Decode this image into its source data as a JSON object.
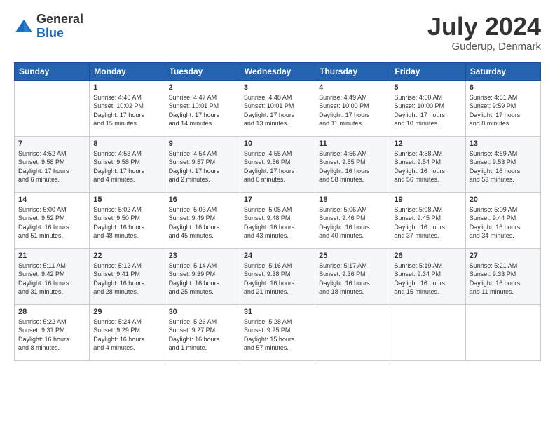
{
  "header": {
    "logo_general": "General",
    "logo_blue": "Blue",
    "month_title": "July 2024",
    "location": "Guderup, Denmark"
  },
  "columns": [
    "Sunday",
    "Monday",
    "Tuesday",
    "Wednesday",
    "Thursday",
    "Friday",
    "Saturday"
  ],
  "weeks": [
    [
      {
        "day": "",
        "info": ""
      },
      {
        "day": "1",
        "info": "Sunrise: 4:46 AM\nSunset: 10:02 PM\nDaylight: 17 hours\nand 15 minutes."
      },
      {
        "day": "2",
        "info": "Sunrise: 4:47 AM\nSunset: 10:01 PM\nDaylight: 17 hours\nand 14 minutes."
      },
      {
        "day": "3",
        "info": "Sunrise: 4:48 AM\nSunset: 10:01 PM\nDaylight: 17 hours\nand 13 minutes."
      },
      {
        "day": "4",
        "info": "Sunrise: 4:49 AM\nSunset: 10:00 PM\nDaylight: 17 hours\nand 11 minutes."
      },
      {
        "day": "5",
        "info": "Sunrise: 4:50 AM\nSunset: 10:00 PM\nDaylight: 17 hours\nand 10 minutes."
      },
      {
        "day": "6",
        "info": "Sunrise: 4:51 AM\nSunset: 9:59 PM\nDaylight: 17 hours\nand 8 minutes."
      }
    ],
    [
      {
        "day": "7",
        "info": "Sunrise: 4:52 AM\nSunset: 9:58 PM\nDaylight: 17 hours\nand 6 minutes."
      },
      {
        "day": "8",
        "info": "Sunrise: 4:53 AM\nSunset: 9:58 PM\nDaylight: 17 hours\nand 4 minutes."
      },
      {
        "day": "9",
        "info": "Sunrise: 4:54 AM\nSunset: 9:57 PM\nDaylight: 17 hours\nand 2 minutes."
      },
      {
        "day": "10",
        "info": "Sunrise: 4:55 AM\nSunset: 9:56 PM\nDaylight: 17 hours\nand 0 minutes."
      },
      {
        "day": "11",
        "info": "Sunrise: 4:56 AM\nSunset: 9:55 PM\nDaylight: 16 hours\nand 58 minutes."
      },
      {
        "day": "12",
        "info": "Sunrise: 4:58 AM\nSunset: 9:54 PM\nDaylight: 16 hours\nand 56 minutes."
      },
      {
        "day": "13",
        "info": "Sunrise: 4:59 AM\nSunset: 9:53 PM\nDaylight: 16 hours\nand 53 minutes."
      }
    ],
    [
      {
        "day": "14",
        "info": "Sunrise: 5:00 AM\nSunset: 9:52 PM\nDaylight: 16 hours\nand 51 minutes."
      },
      {
        "day": "15",
        "info": "Sunrise: 5:02 AM\nSunset: 9:50 PM\nDaylight: 16 hours\nand 48 minutes."
      },
      {
        "day": "16",
        "info": "Sunrise: 5:03 AM\nSunset: 9:49 PM\nDaylight: 16 hours\nand 45 minutes."
      },
      {
        "day": "17",
        "info": "Sunrise: 5:05 AM\nSunset: 9:48 PM\nDaylight: 16 hours\nand 43 minutes."
      },
      {
        "day": "18",
        "info": "Sunrise: 5:06 AM\nSunset: 9:46 PM\nDaylight: 16 hours\nand 40 minutes."
      },
      {
        "day": "19",
        "info": "Sunrise: 5:08 AM\nSunset: 9:45 PM\nDaylight: 16 hours\nand 37 minutes."
      },
      {
        "day": "20",
        "info": "Sunrise: 5:09 AM\nSunset: 9:44 PM\nDaylight: 16 hours\nand 34 minutes."
      }
    ],
    [
      {
        "day": "21",
        "info": "Sunrise: 5:11 AM\nSunset: 9:42 PM\nDaylight: 16 hours\nand 31 minutes."
      },
      {
        "day": "22",
        "info": "Sunrise: 5:12 AM\nSunset: 9:41 PM\nDaylight: 16 hours\nand 28 minutes."
      },
      {
        "day": "23",
        "info": "Sunrise: 5:14 AM\nSunset: 9:39 PM\nDaylight: 16 hours\nand 25 minutes."
      },
      {
        "day": "24",
        "info": "Sunrise: 5:16 AM\nSunset: 9:38 PM\nDaylight: 16 hours\nand 21 minutes."
      },
      {
        "day": "25",
        "info": "Sunrise: 5:17 AM\nSunset: 9:36 PM\nDaylight: 16 hours\nand 18 minutes."
      },
      {
        "day": "26",
        "info": "Sunrise: 5:19 AM\nSunset: 9:34 PM\nDaylight: 16 hours\nand 15 minutes."
      },
      {
        "day": "27",
        "info": "Sunrise: 5:21 AM\nSunset: 9:33 PM\nDaylight: 16 hours\nand 11 minutes."
      }
    ],
    [
      {
        "day": "28",
        "info": "Sunrise: 5:22 AM\nSunset: 9:31 PM\nDaylight: 16 hours\nand 8 minutes."
      },
      {
        "day": "29",
        "info": "Sunrise: 5:24 AM\nSunset: 9:29 PM\nDaylight: 16 hours\nand 4 minutes."
      },
      {
        "day": "30",
        "info": "Sunrise: 5:26 AM\nSunset: 9:27 PM\nDaylight: 16 hours\nand 1 minute."
      },
      {
        "day": "31",
        "info": "Sunrise: 5:28 AM\nSunset: 9:25 PM\nDaylight: 15 hours\nand 57 minutes."
      },
      {
        "day": "",
        "info": ""
      },
      {
        "day": "",
        "info": ""
      },
      {
        "day": "",
        "info": ""
      }
    ]
  ]
}
